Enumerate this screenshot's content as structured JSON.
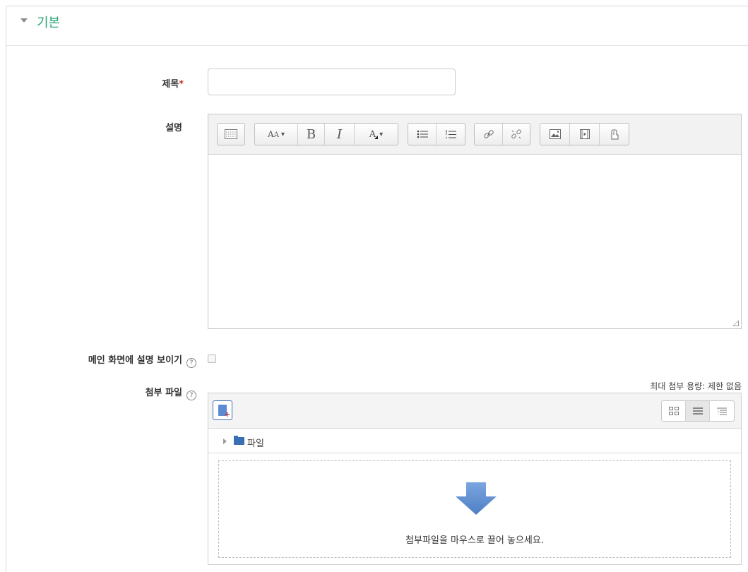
{
  "section": {
    "title": "기본"
  },
  "fields": {
    "title_label": "제목",
    "required_mark": "*",
    "description_label": "설명",
    "show_description_label": "메인 화면에 설명 보이기",
    "attachment_label": "첨부 파일",
    "help_glyph": "?"
  },
  "title_input": {
    "value": "",
    "placeholder": ""
  },
  "editor": {
    "toolbar": {
      "font_glyph": "A",
      "bold": "B",
      "italic": "I",
      "color_glyph": "A",
      "dropdown_glyph": "▾"
    },
    "content": ""
  },
  "show_description_checked": false,
  "file_manager": {
    "max_size_text": "최대 첨부 용량: 제한 없음",
    "folder_label": "파일",
    "dropzone_text": "첨부파일을 마우스로 끌어 놓으세요.",
    "accent_color": "#5b8cd1"
  },
  "colors": {
    "section_title": "#27a572",
    "required": "#c0392b"
  }
}
